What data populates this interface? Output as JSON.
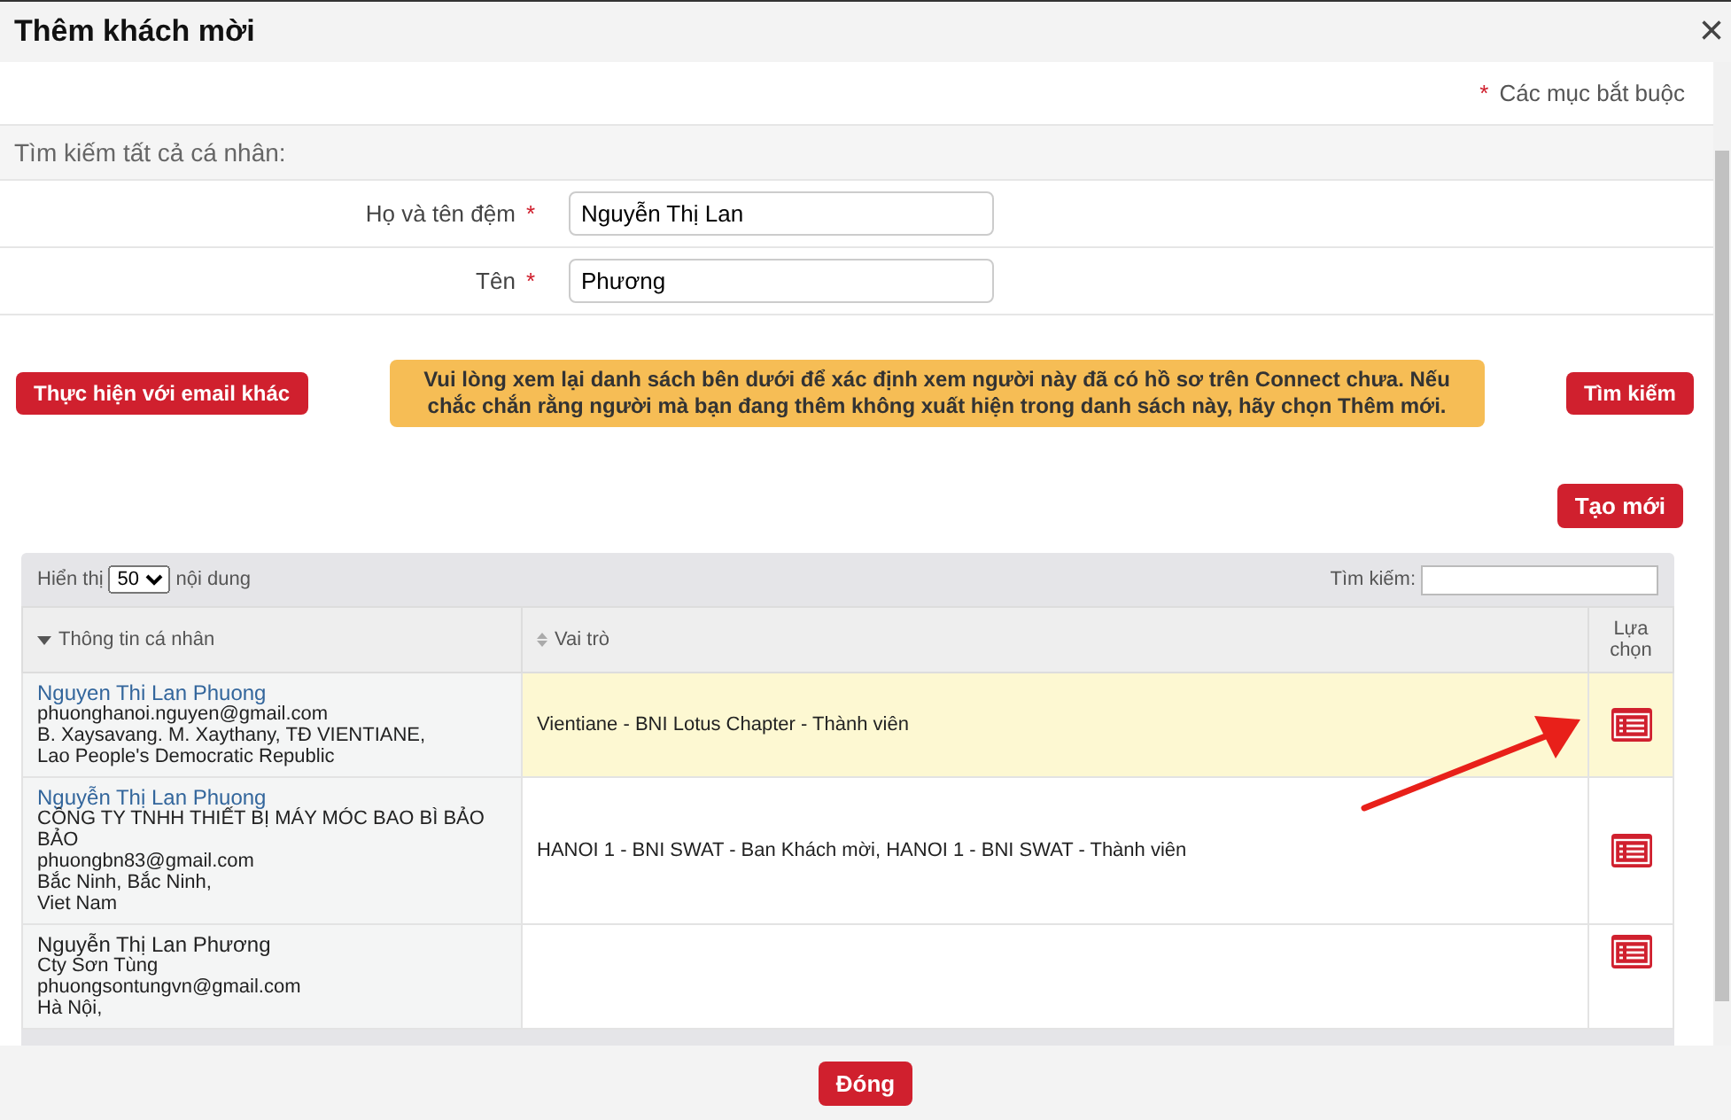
{
  "dialog": {
    "title": "Thêm khách mời",
    "close": "×"
  },
  "required_note": {
    "mark": "*",
    "text": "Các mục bắt buộc"
  },
  "section_title": "Tìm kiếm tất cả cá nhân:",
  "fields": [
    {
      "label": "Họ và tên đệm",
      "mark": "*",
      "value": "Nguyễn Thị Lan"
    },
    {
      "label": "Tên",
      "mark": "*",
      "value": "Phương"
    }
  ],
  "other_email_button": "Thực hiện với email khác",
  "notice": "Vui lòng xem lại danh sách bên dưới để xác định xem người này đã có hồ sơ trên Connect chưa. Nếu chắc chắn rằng người mà bạn đang thêm không xuất hiện trong danh sách này, hãy chọn Thêm mới.",
  "search_button": "Tìm kiếm",
  "create_button": "Tạo mới",
  "table": {
    "show_label": "Hiển thị",
    "page_size": "50",
    "show_suffix": "nội dung",
    "search_label": "Tìm kiếm:",
    "columns": [
      {
        "label": "Thông tin cá nhân",
        "kind": "sorted"
      },
      {
        "label": "Vai trò",
        "kind": "sortable"
      },
      {
        "label": "Lựa chọn",
        "kind": "plain"
      }
    ],
    "rows": [
      {
        "selected": true,
        "name": "Nguyen Thi Lan Phuong",
        "linked": true,
        "details": [
          "phuonghanoi.nguyen@gmail.com",
          "B. Xaysavang. M. Xaythany, TĐ VIENTIANE,",
          "Lao People's Democratic Republic"
        ],
        "role": "Vientiane - BNI Lotus Chapter - Thành viên"
      },
      {
        "selected": false,
        "name": "Nguyễn Thị Lan Phuong",
        "linked": true,
        "details": [
          "CÔNG TY TNHH THIẾT BỊ MÁY MÓC BAO BÌ BẢO BẢO",
          "phuongbn83@gmail.com",
          "Bắc Ninh, Bắc Ninh,",
          "Viet Nam"
        ],
        "role": "HANOI 1 - BNI SWAT - Ban Khách mời, HANOI 1 - BNI SWAT - Thành viên"
      },
      {
        "selected": false,
        "name": "Nguyễn Thị Lan Phương",
        "linked": false,
        "details": [
          "Cty Sơn Tùng",
          "phuongsontungvn@gmail.com",
          "Hà Nội,"
        ],
        "role": ""
      }
    ]
  },
  "close_button": "Đóng"
}
